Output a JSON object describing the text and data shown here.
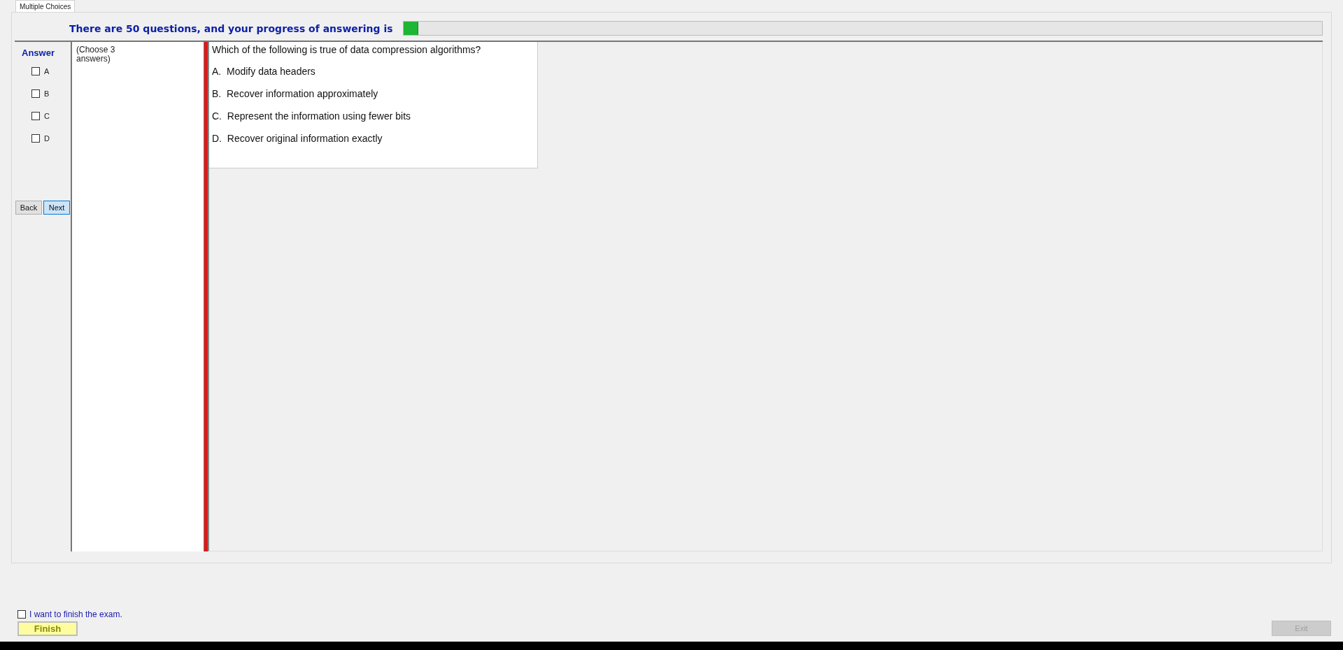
{
  "tabs": [
    {
      "label": "Multiple Choices",
      "selected": true
    }
  ],
  "header": {
    "text": "There are 50 questions, and your progress of answering is",
    "progress": {
      "level": 0.016
    }
  },
  "answer_panel": {
    "title": "Answer",
    "options": [
      {
        "label": "A",
        "checked": false
      },
      {
        "label": "B",
        "checked": false
      },
      {
        "label": "C",
        "checked": false
      },
      {
        "label": "D",
        "checked": false
      }
    ]
  },
  "nav_buttons": [
    {
      "label": "Back",
      "focused": false
    },
    {
      "label": "Next",
      "focused": true
    }
  ],
  "note": "(Choose 3\nanswers)",
  "question": {
    "text": "Which of the following is true of data compression algorithms?",
    "choices": [
      {
        "letter": "A.",
        "text": "Modify data headers"
      },
      {
        "letter": "B.",
        "text": "Recover information approximately"
      },
      {
        "letter": "C.",
        "text": "Represent the information using fewer bits"
      },
      {
        "letter": "D.",
        "text": "Recover original information exactly"
      }
    ]
  },
  "finish_confirm": {
    "label": "I want to finish the exam.",
    "checked": false
  },
  "buttons": [
    {
      "kind": "finish",
      "label": "Finish",
      "disabled": false
    },
    {
      "kind": "exit",
      "label": "Exit",
      "disabled": true
    }
  ]
}
